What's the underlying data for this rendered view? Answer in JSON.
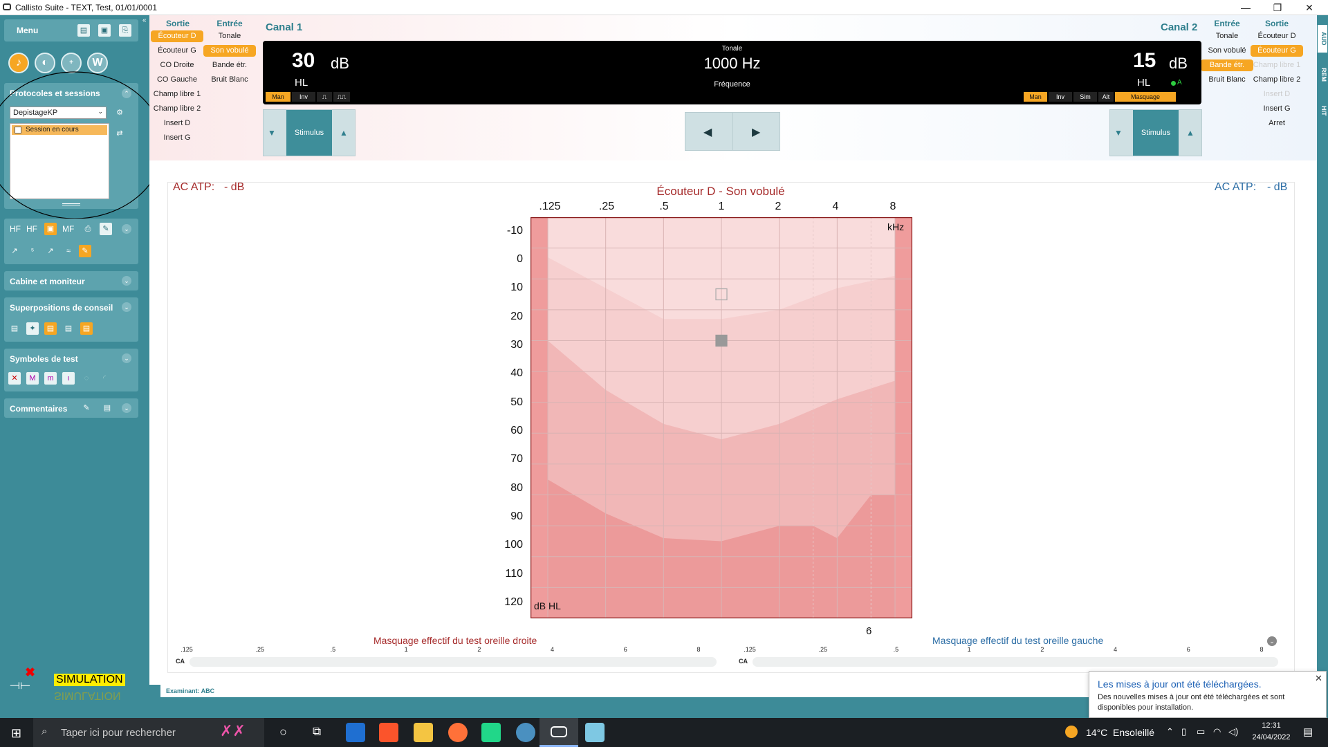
{
  "window": {
    "title": "Callisto Suite - TEXT, Test, 01/01/0001",
    "minimize": "—",
    "maximize": "❐",
    "close": "✕"
  },
  "sidebar": {
    "menu_label": "Menu",
    "protocols_title": "Protocoles et sessions",
    "protocol_select": "DepistageKP",
    "session_item": "Session en cours",
    "toolbar1": [
      "HF",
      "HF",
      "MF"
    ],
    "panels": [
      "Cabine et moniteur",
      "Superpositions de conseil",
      "Symboles de test",
      "Commentaires"
    ],
    "simulation": "SIMULATION"
  },
  "channel1": {
    "title": "Canal 1",
    "sortie_header": "Sortie",
    "entree_header": "Entrée",
    "sortie": [
      "Écouteur D",
      "Écouteur G",
      "CO Droite",
      "CO Gauche",
      "Champ libre 1",
      "Champ libre 2",
      "Insert D",
      "Insert G"
    ],
    "entree": [
      "Tonale",
      "Son vobulé",
      "Bande étr.",
      "Bruit Blanc"
    ],
    "level": "30",
    "unit": "dB",
    "scale": "HL",
    "toggles": [
      "Man",
      "Inv"
    ],
    "stimulus": "Stimulus"
  },
  "center_display": {
    "signal": "Tonale",
    "frequency": "1000 Hz",
    "freq_label": "Fréquence"
  },
  "channel2": {
    "title": "Canal 2",
    "entree_header": "Entrée",
    "sortie_header": "Sortie",
    "entree": [
      "Tonale",
      "Son vobulé",
      "Bande étr.",
      "Bruit Blanc"
    ],
    "sortie": [
      "Écouteur D",
      "Écouteur G",
      "Champ libre 1",
      "Champ libre 2",
      "Insert D",
      "Insert G",
      "Arret"
    ],
    "level": "15",
    "unit": "dB",
    "scale": "HL",
    "indicator": "A",
    "toggles": [
      "Man",
      "Inv",
      "Sim",
      "Alt",
      "Masquage"
    ],
    "stimulus": "Stimulus"
  },
  "right_tabs": [
    "AUD",
    "REM",
    "HIT"
  ],
  "audiogram": {
    "title": "Écouteur D - Son vobulé",
    "atp_left": "AC ATP:",
    "atp_left_val": "- dB",
    "atp_right": "AC ATP:",
    "atp_right_val": "- dB",
    "x_ticks": [
      ".125",
      ".25",
      ".5",
      "1",
      "2",
      "4",
      "8"
    ],
    "x_unit": "kHz",
    "y_ticks": [
      "-10",
      "0",
      "10",
      "20",
      "30",
      "40",
      "50",
      "60",
      "70",
      "80",
      "90",
      "100",
      "110",
      "120"
    ],
    "y_unit": "dB HL",
    "below_label": "6"
  },
  "chart_data": {
    "type": "scatter",
    "title": "Écouteur D - Son vobulé",
    "xlabel": "kHz",
    "ylabel": "dB HL",
    "x_scale": "log",
    "categories": [
      ".125",
      ".25",
      ".5",
      "1",
      "2",
      "4",
      "8"
    ],
    "ylim": [
      120,
      -10
    ],
    "markers": [
      {
        "x": 1,
        "y": 15,
        "shape": "open-square"
      },
      {
        "x": 1,
        "y": 30,
        "shape": "filled-square"
      }
    ],
    "bands": [
      {
        "name": "band1",
        "x": [
          0.125,
          0.25,
          0.5,
          1,
          2,
          4,
          8
        ],
        "y": [
          3,
          13,
          23,
          23,
          20,
          13,
          9
        ]
      },
      {
        "name": "band2",
        "x": [
          0.125,
          0.25,
          0.5,
          1,
          2,
          4,
          8
        ],
        "y": [
          30,
          46,
          57,
          62,
          57,
          49,
          43
        ]
      },
      {
        "name": "band3",
        "x": [
          0.125,
          0.25,
          0.5,
          1,
          2,
          3,
          4,
          6,
          8
        ],
        "y": [
          75,
          86,
          94,
          95,
          90,
          90,
          94,
          80,
          80
        ]
      }
    ],
    "colors": {
      "bg": "#f9dcdc",
      "band": "#f3c2c2",
      "edge": "#ef9c9c"
    }
  },
  "masking": {
    "right_title": "Masquage effectif du test oreille droite",
    "left_title": "Masquage effectif du test oreille gauche",
    "ticks": [
      ".125",
      ".25",
      ".5",
      "1",
      "2",
      "4",
      "6",
      "8"
    ],
    "row_label": "CA"
  },
  "examinant": "Examinant: ABC",
  "toast": {
    "title": "Les mises à jour ont été téléchargées.",
    "body": "Des nouvelles mises à jour ont été téléchargées et sont disponibles pour installation."
  },
  "taskbar": {
    "search_placeholder": "Taper ici pour rechercher",
    "weather": "14°C  Ensoleillé",
    "time": "12:31",
    "date": "24/04/2022"
  }
}
